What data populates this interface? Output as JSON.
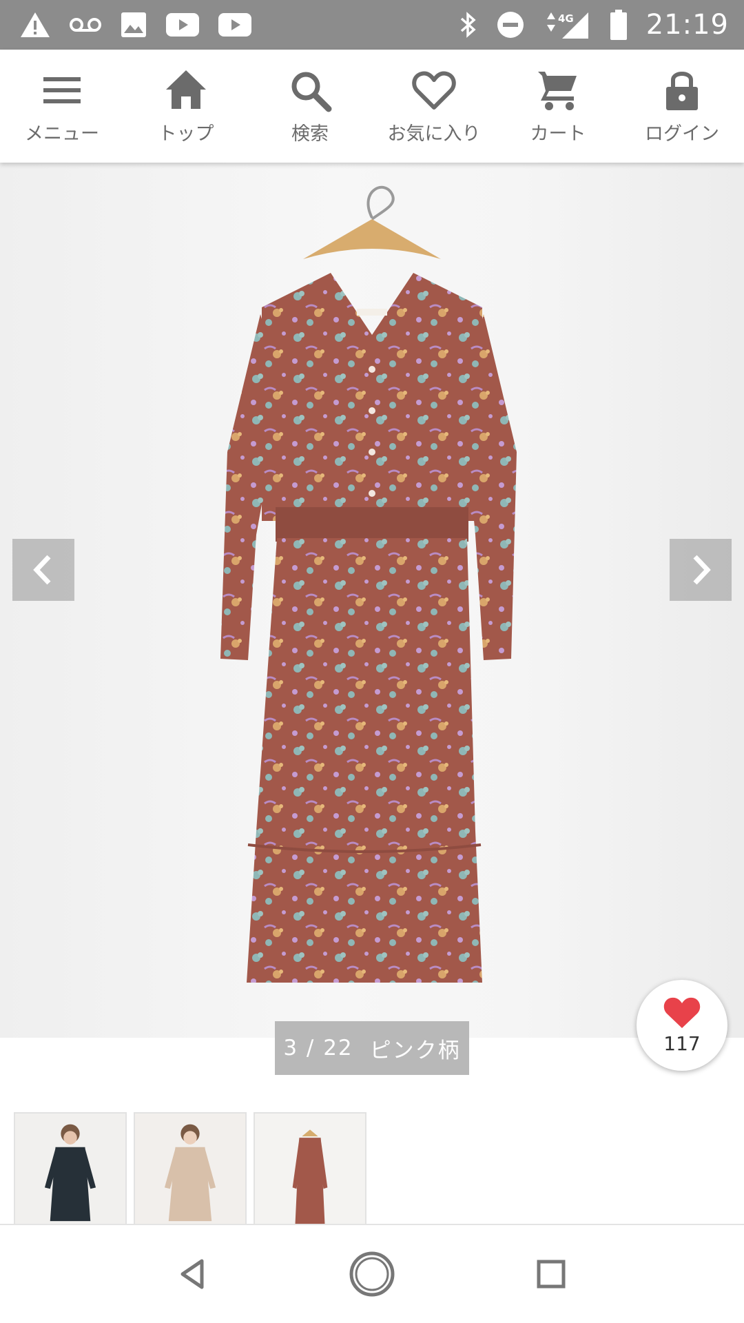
{
  "status_bar": {
    "time": "21:19",
    "network": "4G",
    "left_icons": [
      "warning-icon",
      "voicemail-icon",
      "image-icon",
      "youtube-icon",
      "youtube-icon"
    ],
    "right_icons": [
      "bluetooth-icon",
      "do-not-disturb-icon",
      "signal-icon",
      "battery-icon"
    ]
  },
  "nav": {
    "items": [
      {
        "label": "メニュー",
        "icon": "menu-icon"
      },
      {
        "label": "トップ",
        "icon": "home-icon"
      },
      {
        "label": "検索",
        "icon": "search-icon"
      },
      {
        "label": "お気に入り",
        "icon": "heart-icon"
      },
      {
        "label": "カート",
        "icon": "cart-icon"
      },
      {
        "label": "ログイン",
        "icon": "lock-icon"
      }
    ]
  },
  "gallery": {
    "current": "3",
    "total": "22",
    "position_text": "3 / 22",
    "color_label": "ピンク柄"
  },
  "favorite": {
    "count": "117",
    "color": "#e8424a"
  },
  "thumbnails": [
    {
      "name": "thumb-navy-floral"
    },
    {
      "name": "thumb-beige-floral"
    },
    {
      "name": "thumb-pink-floral"
    }
  ],
  "colors": {
    "status_bar": "#8c8c8c",
    "nav_text": "#6b6b6b",
    "dress": "#a2584a"
  }
}
